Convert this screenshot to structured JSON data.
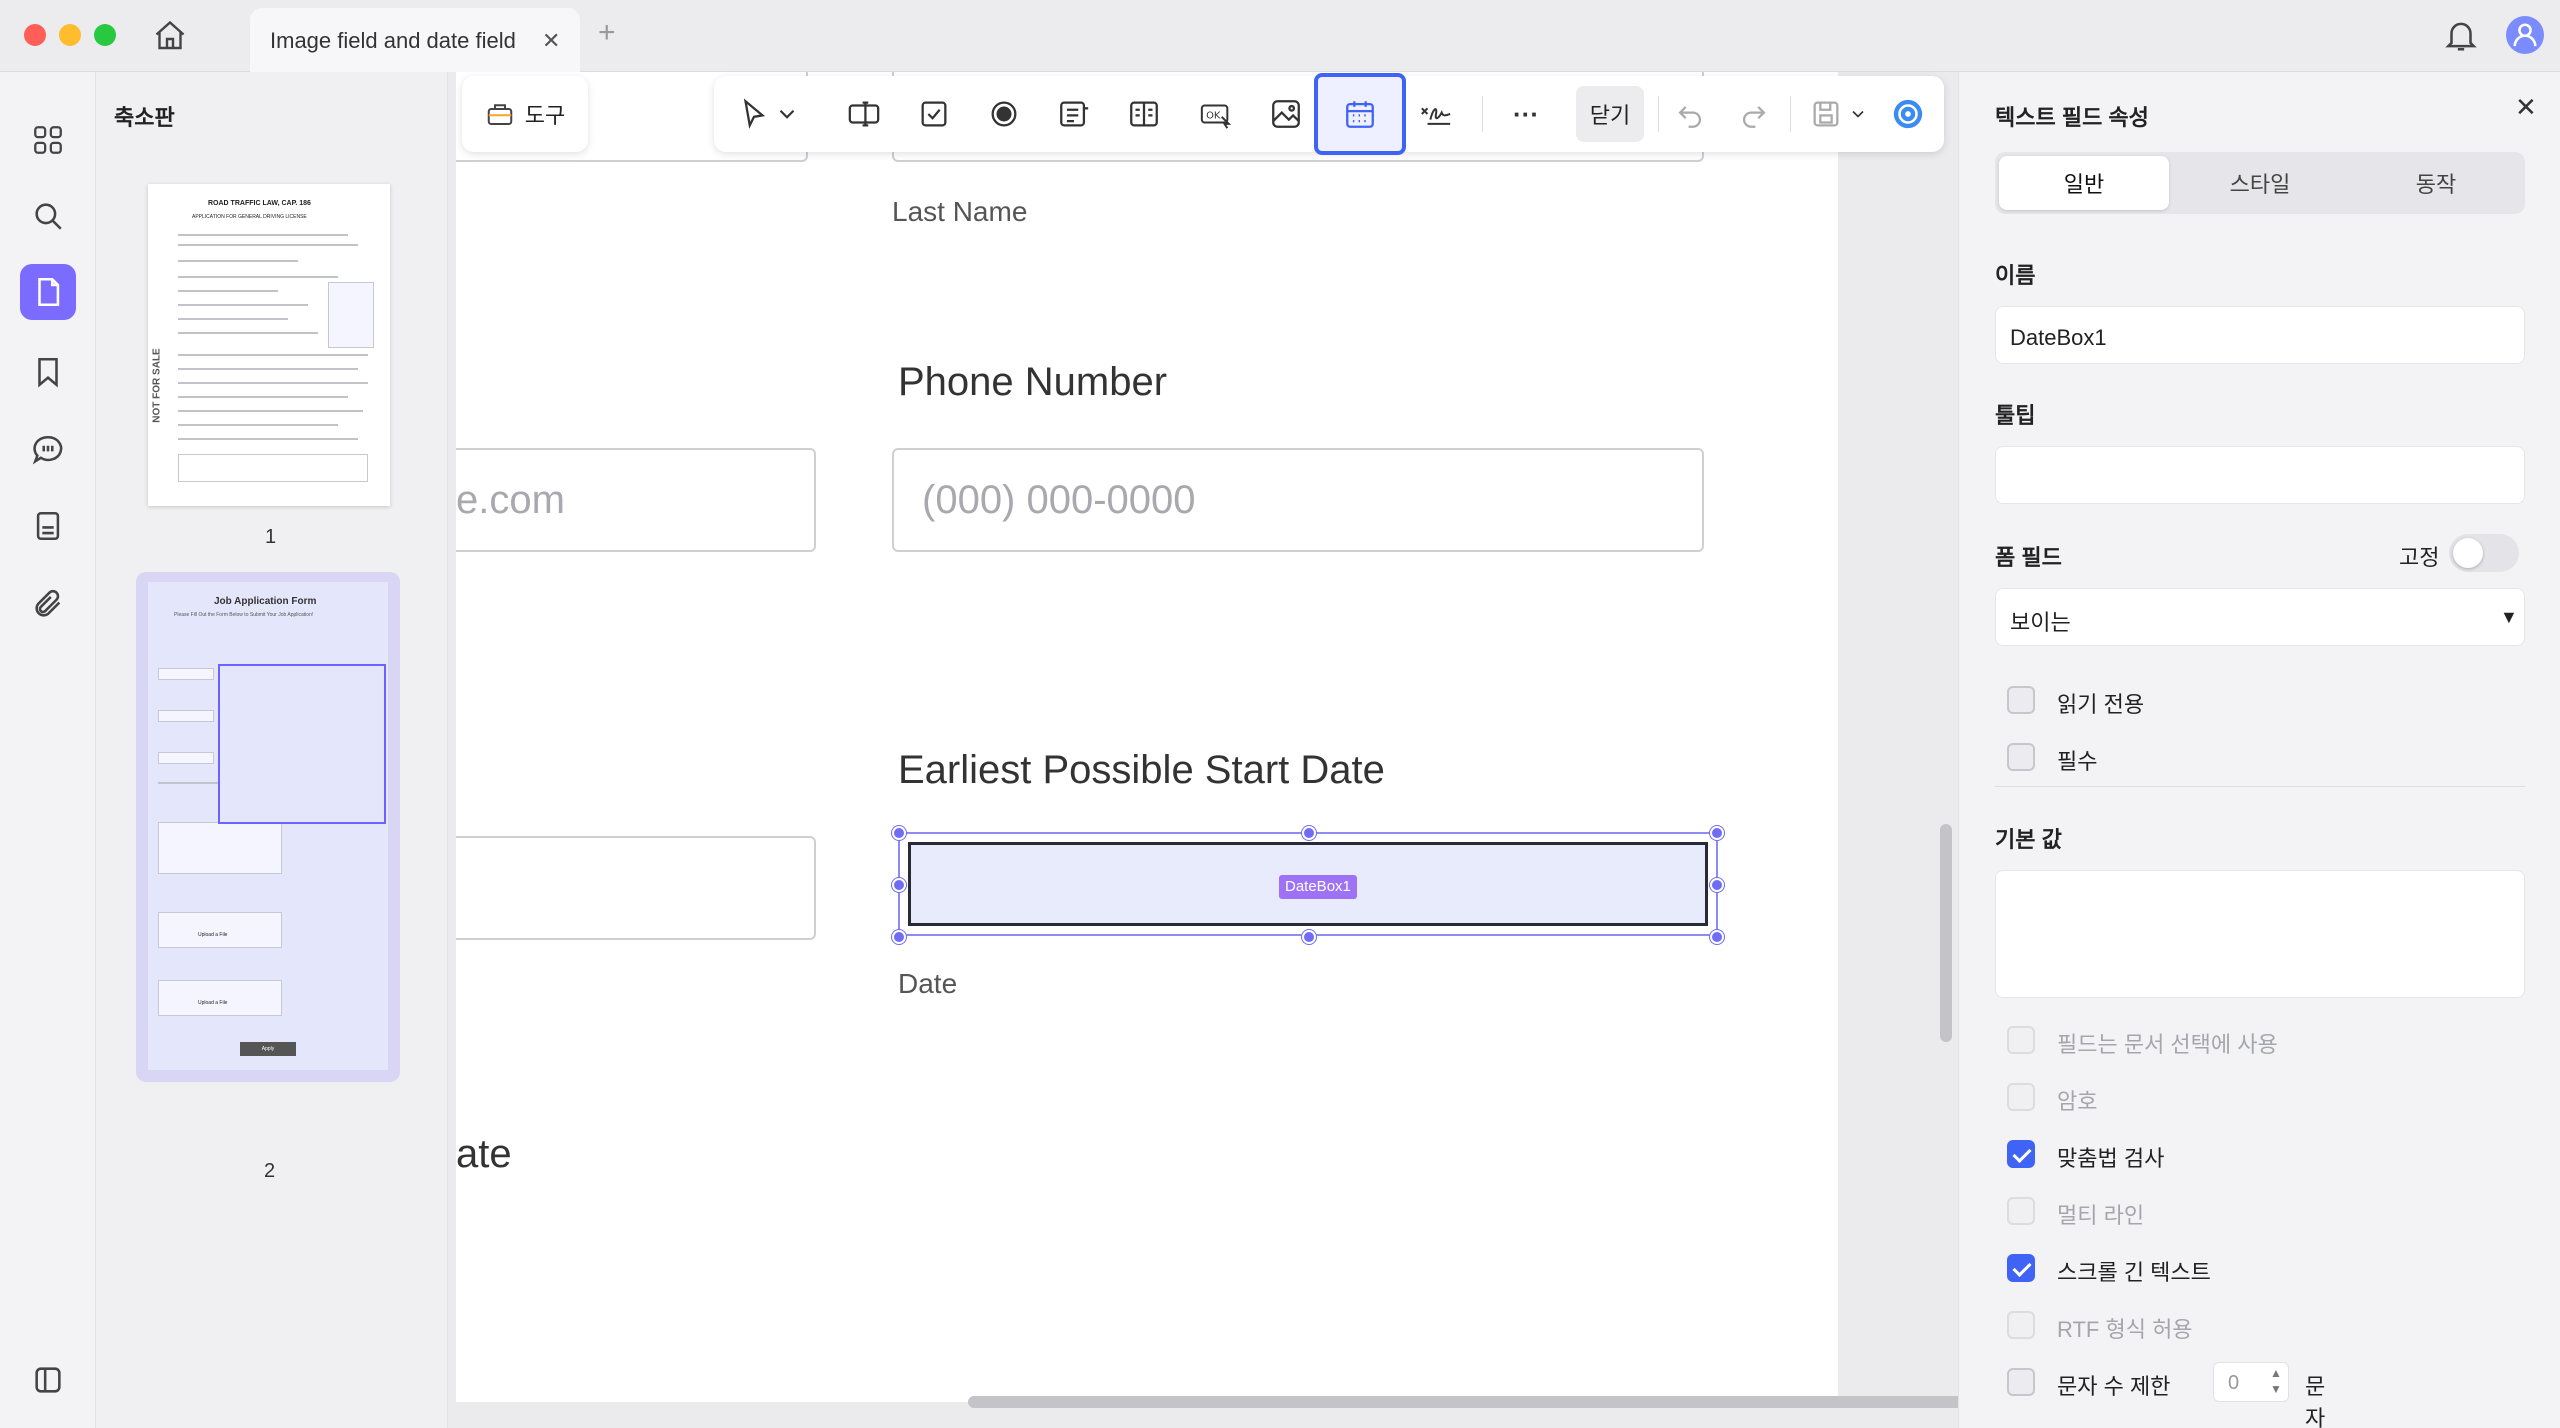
{
  "window": {
    "tab_title": "Image field and date field",
    "tab_close": "✕",
    "tab_add": "+"
  },
  "thumbnails": {
    "title": "축소판",
    "pages": [
      "1",
      "2"
    ],
    "page1_heading": "ROAD TRAFFIC LAW, CAP. 186",
    "page1_subheading": "APPLICATION FOR GENERAL DRIVING LICENSE",
    "page1_watermark": "NOT FOR SALE",
    "page2_heading": "Job Application Form",
    "page2_subheading": "Please Fill Out the Form Below to Submit Your Job Application!",
    "page2_upload": "Upload a File",
    "page2_submit": "Apply"
  },
  "toolbar": {
    "tools_label": "도구",
    "close_label": "닫기",
    "more": "···"
  },
  "document": {
    "last_name_label": "Last Name",
    "phone_label": "Phone Number",
    "phone_placeholder": "(000) 000-0000",
    "email_partial": "e.com",
    "start_date_label": "Earliest Possible Start Date",
    "date_sub_label": "Date",
    "date_field_tag": "DateBox1",
    "partial_label": "ate"
  },
  "panel": {
    "title": "텍스트 필드 속성",
    "close": "✕",
    "tabs": [
      "일반",
      "스타일",
      "동작"
    ],
    "name_label": "이름",
    "name_value": "DateBox1",
    "tooltip_label": "툴팁",
    "tooltip_value": "",
    "form_field_label": "폼 필드",
    "locked_label": "고정",
    "visibility_value": "보이는",
    "readonly_label": "읽기 전용",
    "required_label": "필수",
    "default_label": "기본 값",
    "default_value": "",
    "options": [
      {
        "label": "필드는 문서 선택에 사용",
        "checked": false,
        "enabled": false
      },
      {
        "label": "암호",
        "checked": false,
        "enabled": false
      },
      {
        "label": "맞춤법 검사",
        "checked": true,
        "enabled": true
      },
      {
        "label": "멀티 라인",
        "checked": false,
        "enabled": false
      },
      {
        "label": "스크롤 긴 텍스트",
        "checked": true,
        "enabled": true
      },
      {
        "label": "RTF 형식 허용",
        "checked": false,
        "enabled": false
      }
    ],
    "char_limit_label": "문자 수 제한",
    "char_limit_value": "0",
    "char_limit_unit": "문자"
  }
}
